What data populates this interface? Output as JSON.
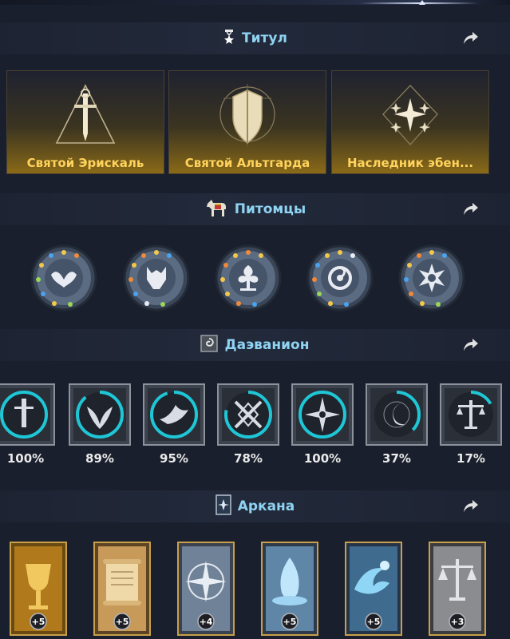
{
  "sections": {
    "title": {
      "label": "Титул",
      "icon": "medal-star-icon"
    },
    "pets": {
      "label": "Питомцы",
      "icon": "horse-icon"
    },
    "daevanion": {
      "label": "Даэванион",
      "icon": "daevanion-rune-icon"
    },
    "arcana": {
      "label": "Аркана",
      "icon": "card-icon"
    }
  },
  "titles": [
    {
      "label": "Святой Эрискаль",
      "icon": "sword-triangle-icon"
    },
    {
      "label": "Святой Альтгарда",
      "icon": "shield-icon"
    },
    {
      "label": "Наследник эбен...",
      "icon": "star-diamond-icon"
    }
  ],
  "pets": [
    {
      "icon": "wings-emblem-icon"
    },
    {
      "icon": "wolf-emblem-icon"
    },
    {
      "icon": "tree-emblem-icon"
    },
    {
      "icon": "swirl-emblem-icon"
    },
    {
      "icon": "sun-emblem-icon"
    }
  ],
  "daevanion": [
    {
      "percent_label": "100%",
      "progress": 1.0,
      "icon": "sword-rune-icon"
    },
    {
      "percent_label": "89%",
      "progress": 0.89,
      "icon": "wings-rune-icon"
    },
    {
      "percent_label": "95%",
      "progress": 0.95,
      "icon": "bird-rune-icon"
    },
    {
      "percent_label": "78%",
      "progress": 0.78,
      "icon": "crossed-swords-rune-icon"
    },
    {
      "percent_label": "100%",
      "progress": 1.0,
      "icon": "cross-star-rune-icon"
    },
    {
      "percent_label": "37%",
      "progress": 0.37,
      "icon": "moon-rune-icon"
    },
    {
      "percent_label": "17%",
      "progress": 0.17,
      "icon": "scales-rune-icon"
    }
  ],
  "arcana": [
    {
      "badge": "+5",
      "theme": "gold",
      "icon": "chalice-card-icon"
    },
    {
      "badge": "+5",
      "theme": "parchment",
      "icon": "scroll-card-icon"
    },
    {
      "badge": "+4",
      "theme": "blue-grey",
      "icon": "compass-card-icon"
    },
    {
      "badge": "+5",
      "theme": "ice",
      "icon": "crystal-card-icon"
    },
    {
      "badge": "+5",
      "theme": "ice",
      "icon": "wave-card-icon"
    },
    {
      "badge": "+3",
      "theme": "stone",
      "icon": "scales-card-icon"
    }
  ],
  "colors": {
    "background": "#1a1f2d",
    "header_text": "#8fd3f2",
    "title_text": "#ffd35c",
    "progress_ring": "#1fc6d6"
  }
}
